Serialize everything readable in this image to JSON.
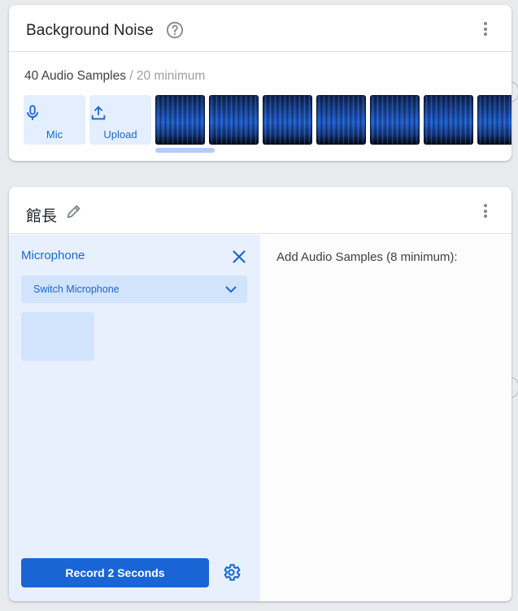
{
  "background_card": {
    "title": "Background Noise",
    "help_icon": "question-circle-icon",
    "menu_icon": "more-vert-icon",
    "samples_count": "40 Audio Samples",
    "samples_minimum": "/ 20 minimum",
    "mic_button": {
      "label": "Mic",
      "icon": "microphone-icon"
    },
    "upload_button": {
      "label": "Upload",
      "icon": "upload-icon"
    },
    "thumbnail_count": 7
  },
  "class_card": {
    "title": "館長",
    "edit_icon": "pencil-icon",
    "menu_icon": "more-vert-icon",
    "microphone_panel": {
      "title": "Microphone",
      "close_icon": "close-icon",
      "switch_label": "Switch Microphone",
      "switch_icon": "chevron-down-icon",
      "record_label": "Record 2 Seconds",
      "settings_icon": "gear-icon"
    },
    "add_samples_label": "Add Audio Samples (8 minimum):"
  },
  "colors": {
    "accent": "#1967d2",
    "record_button": "#1a65d6",
    "panel_bg": "#e8f0fe",
    "page_bg": "#e8eaed"
  }
}
